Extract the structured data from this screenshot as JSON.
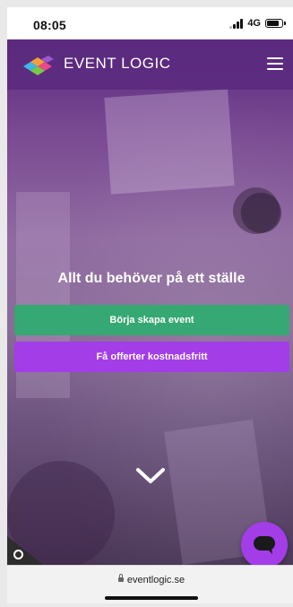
{
  "status_bar": {
    "time": "08:05",
    "network": "4G"
  },
  "nav": {
    "brand": "EVENT LOGIC",
    "menu_icon": "hamburger-menu-icon"
  },
  "hero": {
    "headline": "Allt du behöver på ett ställe",
    "primary_button": "Börja skapa event",
    "secondary_button": "Få offerter kostnadsfritt",
    "scroll_icon": "chevron-down-icon",
    "chat_icon": "chat-bubble-icon"
  },
  "browser": {
    "url": "eventlogic.se"
  },
  "colors": {
    "brand_purple": "#5b2a7f",
    "accent_green": "#35a873",
    "accent_purple": "#a23de8"
  }
}
